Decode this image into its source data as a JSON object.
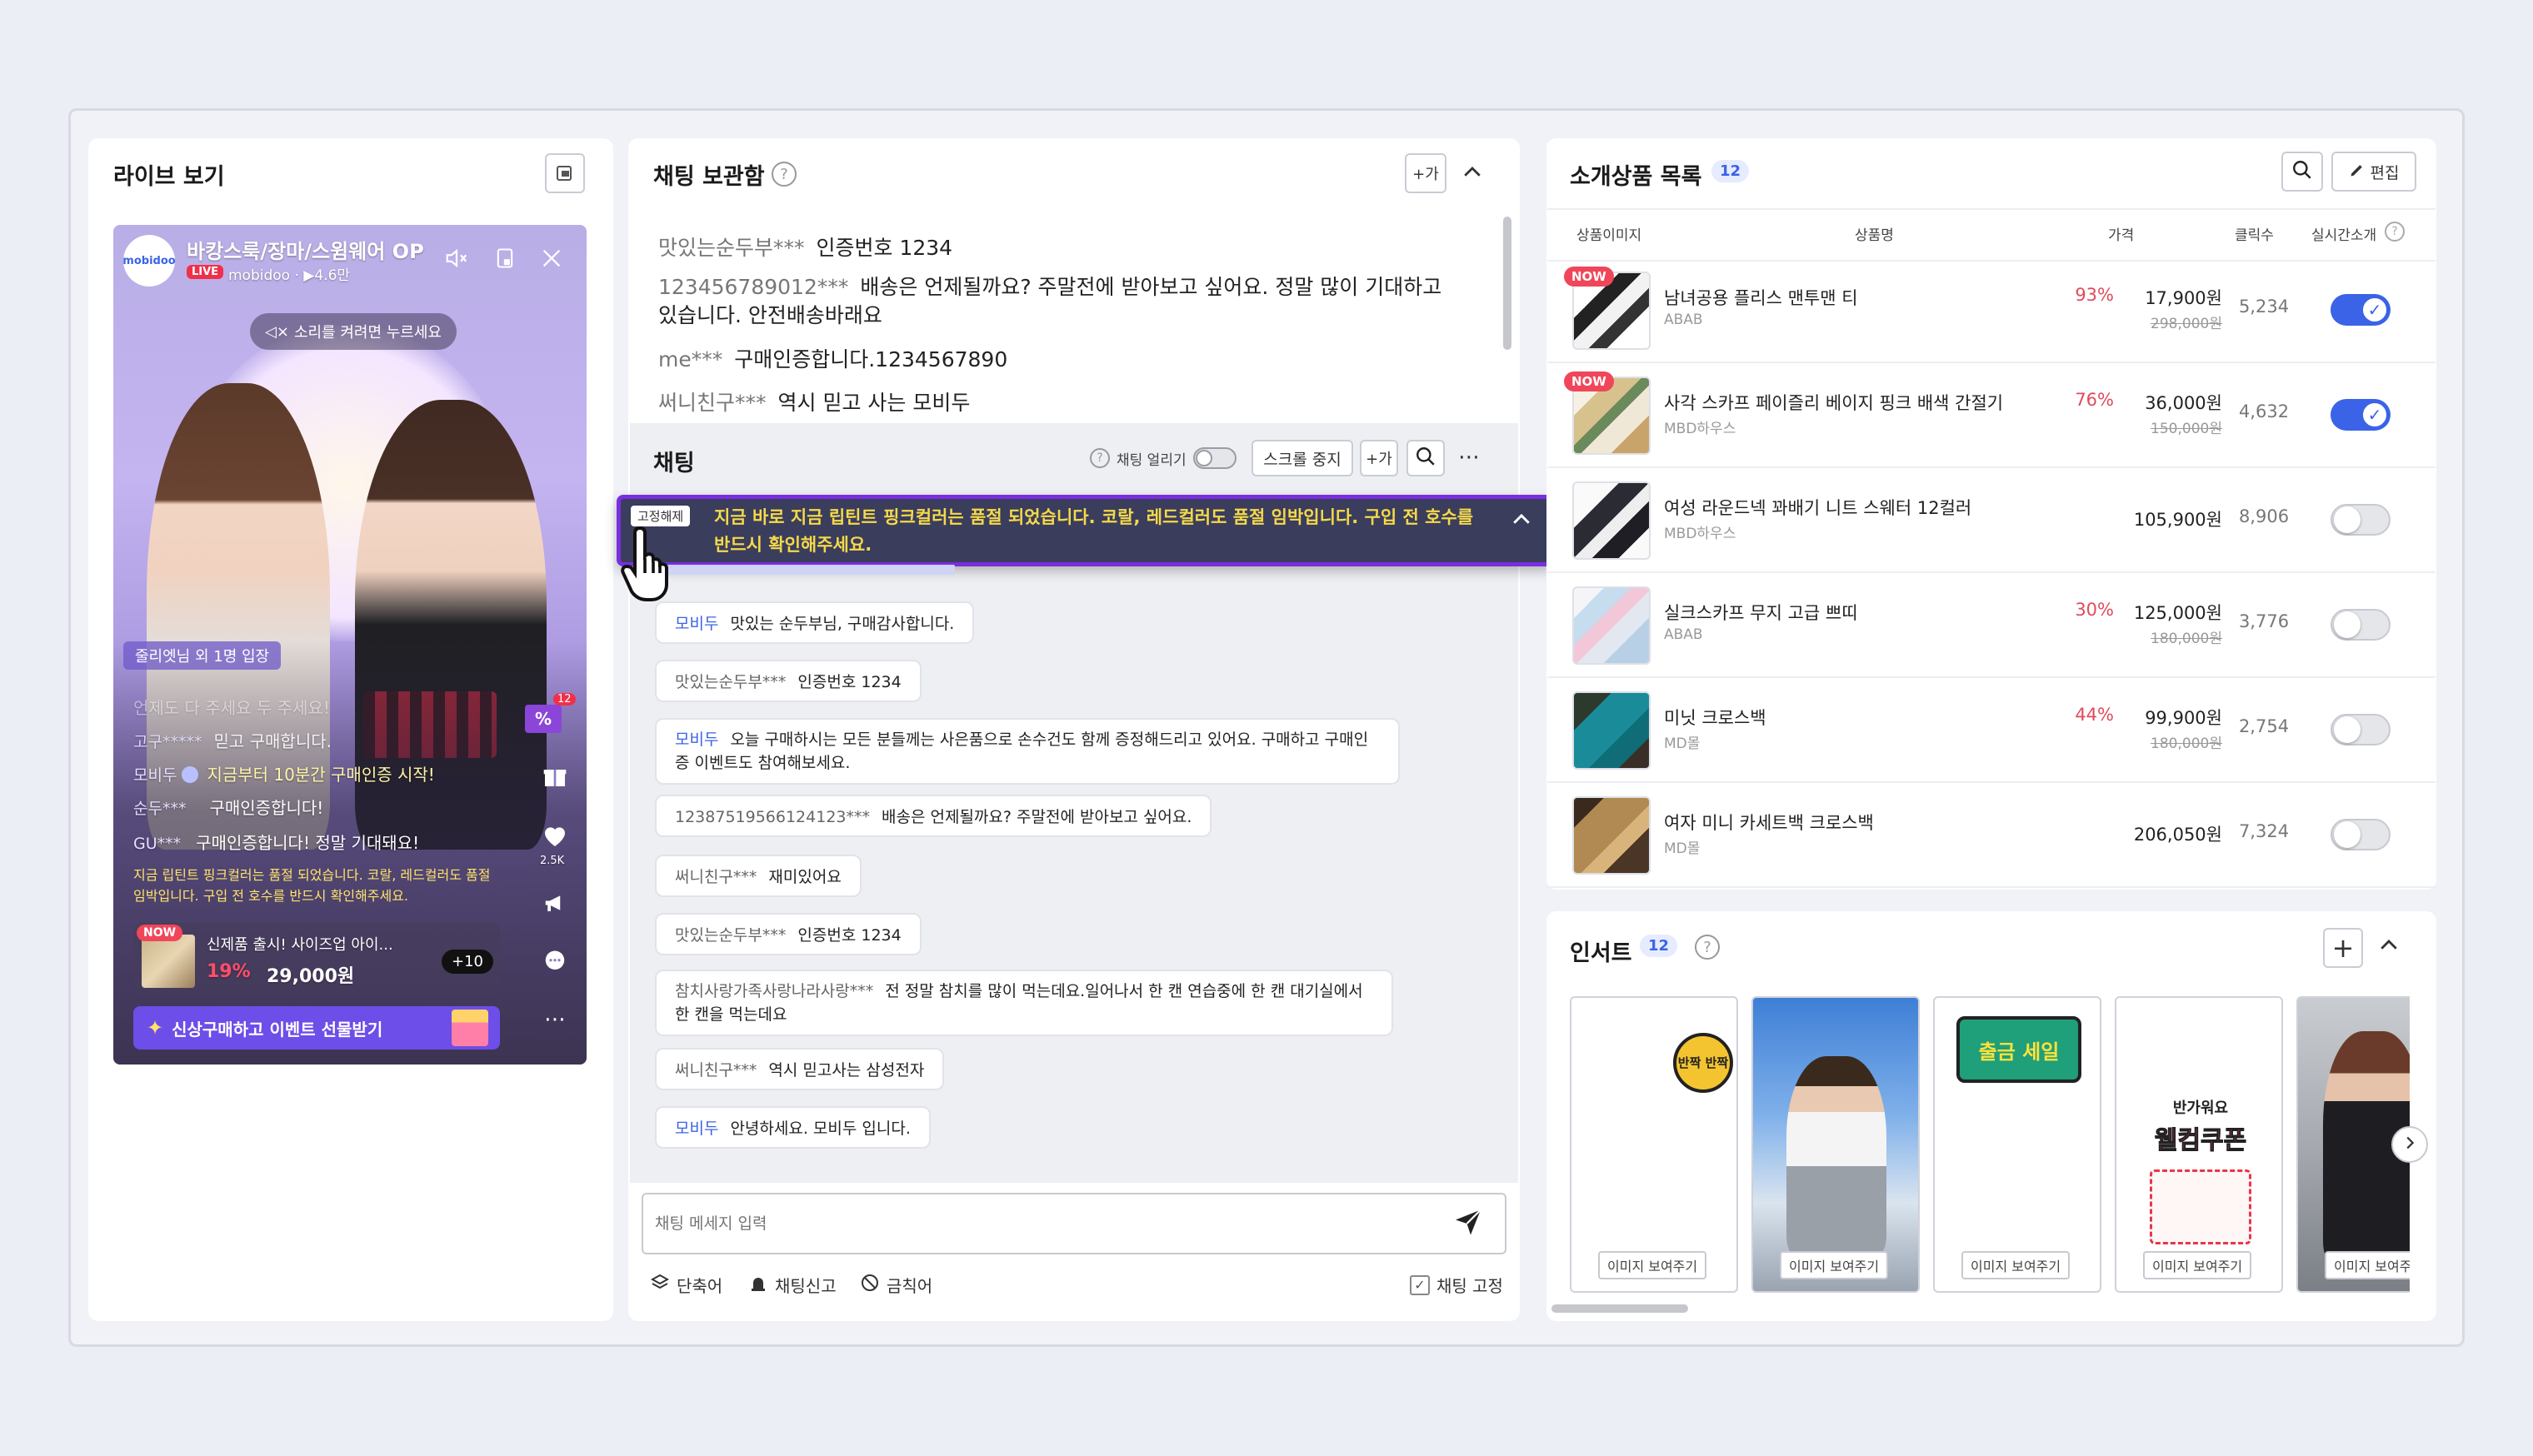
{
  "colors": {
    "accent": "#3b63e7",
    "pin_bg": "#3a3d5c",
    "pin_text": "#f5d94a",
    "pin_border": "#7a2ee0",
    "now": "#f0465a",
    "discount": "#e04b5a"
  },
  "live": {
    "title": "라이브 보기",
    "channel_name": "바캉스룩/장마/스윔웨어 OP",
    "logo_text": "mobidoo",
    "live_badge": "LIVE",
    "meta": "mobidoo · ▶4.6만",
    "sound_hint": "소리를 켜려면 누르세요",
    "entry": "줄리엣님 외 1명 입장",
    "chat": [
      {
        "name": "",
        "text": "언제도 다 주세요 두 주세요!"
      },
      {
        "name": "고구*****",
        "text": "믿고 구매합니다."
      },
      {
        "name": "모비두",
        "text": "지금부터 10분간 구매인증 시작!"
      },
      {
        "name": "순두***",
        "text": "구매인증합니다!"
      },
      {
        "name": "GU***",
        "text": "구매인증합니다! 정말 기대돼요!"
      }
    ],
    "pinned": "지금 립틴트 핑크컬러는 품절 되었습니다. 코랄, 레드컬러도 품절 임박입니다. 구입 전 호수를 반드시 확인해주세요.",
    "product_badge": "NOW",
    "product_title": "신제품 출시! 사이즈업 아이...",
    "product_discount": "19%",
    "product_price": "29,000원",
    "product_more": "+10",
    "cta": "신상구매하고 이벤트 선물받기",
    "coupon_count": "12",
    "like_count": "2.5K",
    "percent": "%"
  },
  "archive": {
    "title": "채팅 보관함",
    "add": "+가",
    "messages": [
      {
        "name": "맛있는순두부***",
        "text": "인증번호 1234"
      },
      {
        "name": "123456789012***",
        "text": "배송은 언제될까요? 주말전에 받아보고 싶어요. 정말 많이 기대하고 있습니다. 안전배송바래요"
      },
      {
        "name": "me***",
        "text": "구매인증합니다.1234567890"
      },
      {
        "name": "써니친구***",
        "text": "역시 믿고 사는 모비두"
      }
    ]
  },
  "chat": {
    "title": "채팅",
    "freeze_label": "채팅 얼리기",
    "scroll_stop": "스크롤 중지",
    "add": "+가",
    "pin_unpin": "고정해제",
    "pinned": "지금 바로 지금 립틴트 핑크컬러는 품절 되었습니다. 코랄, 레드컬러도 품절 임박입니다. 구입 전 호수를 반드시 확인해주세요.",
    "messages": [
      {
        "name": "모비두",
        "text": "맛있는 순두부님, 구매감사합니다.",
        "staff": true
      },
      {
        "name": "맛있는순두부***",
        "text": "인증번호 1234"
      },
      {
        "name": "모비두",
        "text": "오늘 구매하시는 모든 분들께는 사은품으로 손수건도 함께 증정해드리고 있어요. 구매하고 구매인증 이벤트도 참여해보세요.",
        "staff": true
      },
      {
        "name": "12387519566124123***",
        "text": "배송은 언제될까요? 주말전에 받아보고 싶어요."
      },
      {
        "name": "써니친구***",
        "text": "재미있어요"
      },
      {
        "name": "맛있는순두부***",
        "text": "인증번호 1234"
      },
      {
        "name": "참치사랑가족사랑나라사랑***",
        "text": "전 정말 참치를 많이 먹는데요.일어나서 한 캔 연습중에 한 캔 대기실에서한 캔을 먹는데요"
      },
      {
        "name": "써니친구***",
        "text": "역시 믿고사는 삼성전자"
      },
      {
        "name": "모비두",
        "text": "안녕하세요. 모비두 입니다.",
        "staff": true
      }
    ],
    "placeholder": "채팅 메세지 입력",
    "banned_words": "단축어",
    "report": "채팅신고",
    "forbidden": "금칙어",
    "pin_chat": "채팅 고정"
  },
  "products": {
    "title": "소개상품 목록",
    "count": "12",
    "edit": "편집",
    "headers": {
      "image": "상품이미지",
      "name": "상품명",
      "price": "가격",
      "clicks": "클릭수",
      "live": "실시간소개"
    },
    "rows": [
      {
        "now": "NOW",
        "name": "남녀공용 플리스 맨투맨 티",
        "seller": "ABAB",
        "discount": "93%",
        "price": "17,900원",
        "original": "298,000원",
        "clicks": "5,234",
        "live": true
      },
      {
        "now": "NOW",
        "name": "사각 스카프 페이즐리 베이지 핑크 배색 간절기",
        "seller": "MBD하우스",
        "discount": "76%",
        "price": "36,000원",
        "original": "150,000원",
        "clicks": "4,632",
        "live": true
      },
      {
        "now": "",
        "name": "여성 라운드넥 꽈배기 니트 스웨터 12컬러",
        "seller": "MBD하우스",
        "discount": "",
        "price": "105,900원",
        "original": "",
        "clicks": "8,906",
        "live": false
      },
      {
        "now": "",
        "name": "실크스카프 무지 고급 쁘띠",
        "seller": "ABAB",
        "discount": "30%",
        "price": "125,000원",
        "original": "180,000원",
        "clicks": "3,776",
        "live": false
      },
      {
        "now": "",
        "name": "미닛 크로스백",
        "seller": "MD몰",
        "discount": "44%",
        "price": "99,900원",
        "original": "180,000원",
        "clicks": "2,754",
        "live": false
      },
      {
        "now": "",
        "name": "여자 미니 카세트백 크로스백",
        "seller": "MD몰",
        "discount": "",
        "price": "206,050원",
        "original": "",
        "clicks": "7,324",
        "live": false
      }
    ]
  },
  "insert": {
    "title": "인서트",
    "count": "12",
    "show_image": "이미지 보여주기",
    "sticker1": "반짝 반짝",
    "sticker2": "출금 세일",
    "sticker3_top": "반가워요",
    "sticker3_main": "웰컴쿠폰"
  }
}
